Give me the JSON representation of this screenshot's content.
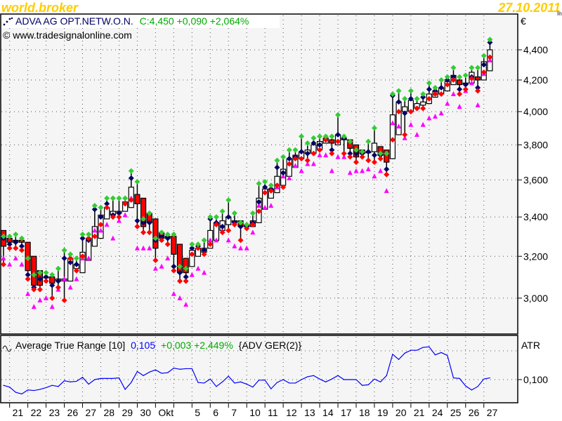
{
  "header": {
    "brand": "world.broker",
    "date": "27.10.2011",
    "corner_text": "In"
  },
  "legend": {
    "symbol": "ADVA AG OPT.NETW.O.N.",
    "quote": "C:4,450 +0,090 +2,064%",
    "copyright": "© www.tradesignalonline.com"
  },
  "atr_legend": {
    "name": "Average True Range [10]",
    "value": "0,105",
    "change": "+0,003 +2,449%",
    "source": "{ADV GER(2)}"
  },
  "axes": {
    "price_unit": "€",
    "price_ticks": [
      "3,000",
      "3,200",
      "3,400",
      "3,600",
      "3,800",
      "4,000",
      "4,200",
      "4,400"
    ],
    "atr_unit": "ATR",
    "atr_ticks": [
      "0,100"
    ],
    "date_labels": [
      "21",
      "22",
      "23",
      "26",
      "27",
      "28",
      "29",
      "30",
      "Okt",
      "5",
      "6",
      "7",
      "10",
      "11",
      "12",
      "13",
      "14",
      "17",
      "18",
      "19",
      "20",
      "21",
      "24",
      "25",
      "26",
      "27"
    ],
    "date_label_day_index": [
      0,
      1,
      2,
      3,
      4,
      5,
      6,
      7,
      8,
      10,
      11,
      12,
      13,
      14,
      15,
      16,
      17,
      18,
      19,
      20,
      21,
      22,
      23,
      24,
      25,
      26
    ]
  },
  "colors": {
    "up_body": "#ffffff",
    "down_body": "#ff0000",
    "marker_green": "#33cc33",
    "marker_navy": "#000066",
    "marker_red": "#ff0000",
    "marker_magenta": "#ff00ff",
    "atr_line": "#0000ff",
    "brand": "#ffcc00",
    "quote_green": "#00aa00"
  },
  "chart_data": [
    {
      "type": "candlestick",
      "title": "ADVA AG OPT.NETW.O.N.",
      "scale": "log",
      "ylim": [
        2.86,
        4.56
      ],
      "candles_per_day": 3,
      "days": 27,
      "fields": [
        "open",
        "close",
        "marker_green",
        "marker_navy",
        "marker_red",
        "marker_magenta"
      ],
      "candles": [
        [
          3.33,
          3.25,
          3.3,
          3.29,
          3.16,
          3.19
        ],
        [
          3.29,
          3.27,
          3.3,
          3.26,
          3.24,
          3.16
        ],
        [
          3.28,
          3.27,
          3.31,
          3.27,
          3.24,
          3.19
        ],
        [
          3.28,
          3.27,
          3.29,
          3.25,
          3.23,
          3.16
        ],
        [
          3.27,
          3.13,
          3.19,
          3.11,
          3.09,
          3.02
        ],
        [
          3.2,
          3.06,
          3.11,
          3.05,
          3.04,
          2.96
        ],
        [
          3.13,
          3.06,
          3.12,
          3.09,
          3.04,
          2.99
        ],
        [
          3.1,
          3.1,
          3.12,
          3.1,
          3.08,
          3.0
        ],
        [
          3.1,
          3.07,
          3.11,
          3.06,
          3.0,
          2.96
        ],
        [
          3.08,
          3.09,
          3.14,
          3.08,
          3.05,
          3.04
        ],
        [
          3.08,
          3.09,
          3.23,
          3.19,
          2.99,
          3.09
        ],
        [
          3.08,
          3.19,
          3.21,
          3.17,
          3.19,
          3.05
        ],
        [
          3.14,
          3.16,
          3.19,
          3.16,
          3.13,
          3.09
        ],
        [
          3.12,
          3.22,
          3.31,
          3.29,
          3.2,
          3.19
        ],
        [
          3.18,
          3.29,
          3.31,
          3.28,
          3.29,
          3.19
        ],
        [
          3.25,
          3.35,
          3.46,
          3.44,
          3.3,
          3.33
        ],
        [
          3.29,
          3.41,
          3.45,
          3.4,
          3.36,
          3.33
        ],
        [
          3.39,
          3.45,
          3.5,
          3.47,
          3.45,
          3.36
        ],
        [
          3.41,
          3.43,
          3.5,
          3.41,
          3.4,
          3.29
        ],
        [
          3.42,
          3.43,
          3.5,
          3.42,
          3.4,
          3.38
        ],
        [
          3.43,
          3.48,
          3.5,
          3.47,
          3.47,
          3.41
        ],
        [
          3.45,
          3.56,
          3.65,
          3.61,
          3.49,
          3.5
        ],
        [
          3.52,
          3.47,
          3.59,
          3.38,
          3.35,
          3.24
        ],
        [
          3.5,
          3.35,
          3.39,
          3.37,
          3.32,
          3.24
        ],
        [
          3.42,
          3.37,
          3.42,
          3.37,
          3.32,
          3.24
        ],
        [
          3.39,
          3.24,
          3.29,
          3.28,
          3.18,
          3.14
        ],
        [
          3.32,
          3.29,
          3.32,
          3.3,
          3.28,
          3.15
        ],
        [
          3.3,
          3.29,
          3.31,
          3.29,
          3.26,
          3.19
        ],
        [
          3.3,
          3.21,
          3.31,
          3.15,
          3.13,
          3.02
        ],
        [
          3.26,
          3.12,
          3.15,
          3.12,
          3.08,
          3.0
        ],
        [
          3.19,
          3.12,
          3.14,
          3.1,
          3.08,
          2.97
        ],
        [
          3.15,
          3.23,
          3.26,
          3.24,
          3.21,
          3.11
        ],
        [
          3.2,
          3.24,
          3.26,
          3.25,
          3.24,
          3.14
        ],
        [
          3.22,
          3.24,
          3.28,
          3.23,
          3.21,
          3.12
        ],
        [
          3.24,
          3.33,
          3.4,
          3.39,
          3.26,
          3.28
        ],
        [
          3.28,
          3.37,
          3.4,
          3.37,
          3.36,
          3.28
        ],
        [
          3.33,
          3.38,
          3.43,
          3.35,
          3.32,
          3.33
        ],
        [
          3.36,
          3.4,
          3.49,
          3.4,
          3.33,
          3.28
        ],
        [
          3.38,
          3.38,
          3.42,
          3.37,
          3.36,
          3.25
        ],
        [
          3.38,
          3.35,
          3.37,
          3.35,
          3.28,
          3.24
        ],
        [
          3.36,
          3.35,
          3.36,
          3.35,
          3.34,
          3.24
        ],
        [
          3.35,
          3.38,
          3.42,
          3.37,
          3.36,
          3.32
        ],
        [
          3.37,
          3.5,
          3.58,
          3.48,
          3.43,
          3.46
        ],
        [
          3.44,
          3.55,
          3.59,
          3.56,
          3.53,
          3.45
        ],
        [
          3.5,
          3.55,
          3.57,
          3.55,
          3.54,
          3.46
        ],
        [
          3.53,
          3.62,
          3.71,
          3.67,
          3.57,
          3.56
        ],
        [
          3.57,
          3.66,
          3.73,
          3.64,
          3.56,
          3.62
        ],
        [
          3.62,
          3.72,
          3.77,
          3.72,
          3.69,
          3.61
        ],
        [
          3.67,
          3.74,
          3.77,
          3.73,
          3.72,
          3.68
        ],
        [
          3.72,
          3.76,
          3.85,
          3.76,
          3.72,
          3.65
        ],
        [
          3.75,
          3.77,
          3.81,
          3.75,
          3.71,
          3.69
        ],
        [
          3.75,
          3.8,
          3.84,
          3.81,
          3.75,
          3.69
        ],
        [
          3.77,
          3.82,
          3.85,
          3.8,
          3.77,
          3.74
        ],
        [
          3.81,
          3.84,
          3.85,
          3.83,
          3.83,
          3.74
        ],
        [
          3.83,
          3.81,
          3.85,
          3.77,
          3.75,
          3.65
        ],
        [
          3.8,
          3.86,
          3.98,
          3.86,
          3.82,
          3.73
        ],
        [
          3.84,
          3.83,
          3.85,
          3.84,
          3.75,
          3.73
        ],
        [
          3.83,
          3.78,
          3.82,
          3.75,
          3.73,
          3.64
        ],
        [
          3.8,
          3.73,
          3.77,
          3.75,
          3.7,
          3.65
        ],
        [
          3.77,
          3.75,
          3.76,
          3.75,
          3.73,
          3.65
        ],
        [
          3.76,
          3.76,
          3.82,
          3.76,
          3.71,
          3.66
        ],
        [
          3.76,
          3.81,
          3.9,
          3.74,
          3.7,
          3.62
        ],
        [
          3.79,
          3.74,
          3.75,
          3.74,
          3.72,
          3.65
        ],
        [
          3.77,
          3.7,
          3.75,
          3.66,
          3.63,
          3.54
        ],
        [
          3.72,
          3.98,
          4.11,
          4.1,
          3.83,
          3.93
        ],
        [
          3.86,
          4.06,
          4.13,
          4.06,
          4.0,
          3.91
        ],
        [
          4.0,
          4.03,
          4.08,
          3.99,
          3.86,
          3.84
        ],
        [
          4.0,
          4.07,
          4.13,
          4.08,
          4.0,
          3.92
        ],
        [
          4.02,
          4.05,
          4.08,
          4.02,
          4.02,
          3.86
        ],
        [
          4.04,
          4.06,
          4.11,
          4.09,
          4.02,
          3.92
        ],
        [
          4.05,
          4.11,
          4.18,
          4.14,
          4.08,
          3.96
        ],
        [
          4.09,
          4.13,
          4.15,
          4.13,
          4.11,
          3.97
        ],
        [
          4.11,
          4.15,
          4.2,
          4.15,
          4.11,
          3.99
        ],
        [
          4.13,
          4.19,
          4.22,
          4.2,
          4.17,
          4.05
        ],
        [
          4.17,
          4.23,
          4.28,
          4.22,
          4.2,
          4.11
        ],
        [
          4.2,
          4.17,
          4.22,
          4.14,
          4.11,
          4.03
        ],
        [
          4.18,
          4.18,
          4.23,
          4.17,
          4.14,
          4.13
        ],
        [
          4.18,
          4.25,
          4.28,
          4.22,
          4.21,
          4.18
        ],
        [
          4.22,
          4.2,
          4.28,
          4.15,
          4.13,
          4.04
        ],
        [
          4.2,
          4.32,
          4.36,
          4.3,
          4.25,
          4.24
        ],
        [
          4.26,
          4.4,
          4.47,
          4.45,
          4.35,
          4.33
        ]
      ],
      "price_gridlines": [
        3.0,
        3.2,
        3.4,
        3.6,
        3.8,
        4.0,
        4.2,
        4.4
      ]
    },
    {
      "type": "line",
      "title": "Average True Range [10]",
      "ylabel": "ATR",
      "ylim": [
        0.06,
        0.175
      ],
      "gridlines": [
        0.1,
        0.15
      ],
      "values": [
        0.09,
        0.087,
        0.078,
        0.075,
        0.082,
        0.081,
        0.083,
        0.086,
        0.09,
        0.088,
        0.098,
        0.096,
        0.097,
        0.104,
        0.092,
        0.1,
        0.102,
        0.102,
        0.102,
        0.103,
        0.083,
        0.095,
        0.114,
        0.107,
        0.113,
        0.117,
        0.111,
        0.112,
        0.12,
        0.118,
        0.119,
        0.119,
        0.095,
        0.094,
        0.101,
        0.088,
        0.096,
        0.106,
        0.094,
        0.096,
        0.092,
        0.087,
        0.099,
        0.099,
        0.084,
        0.095,
        0.1,
        0.094,
        0.094,
        0.1,
        0.105,
        0.107,
        0.101,
        0.096,
        0.101,
        0.107,
        0.1,
        0.1,
        0.1,
        0.09,
        0.091,
        0.101,
        0.096,
        0.107,
        0.144,
        0.135,
        0.146,
        0.151,
        0.151,
        0.156,
        0.157,
        0.143,
        0.147,
        0.142,
        0.103,
        0.102,
        0.089,
        0.082,
        0.088,
        0.101,
        0.103
      ]
    }
  ]
}
